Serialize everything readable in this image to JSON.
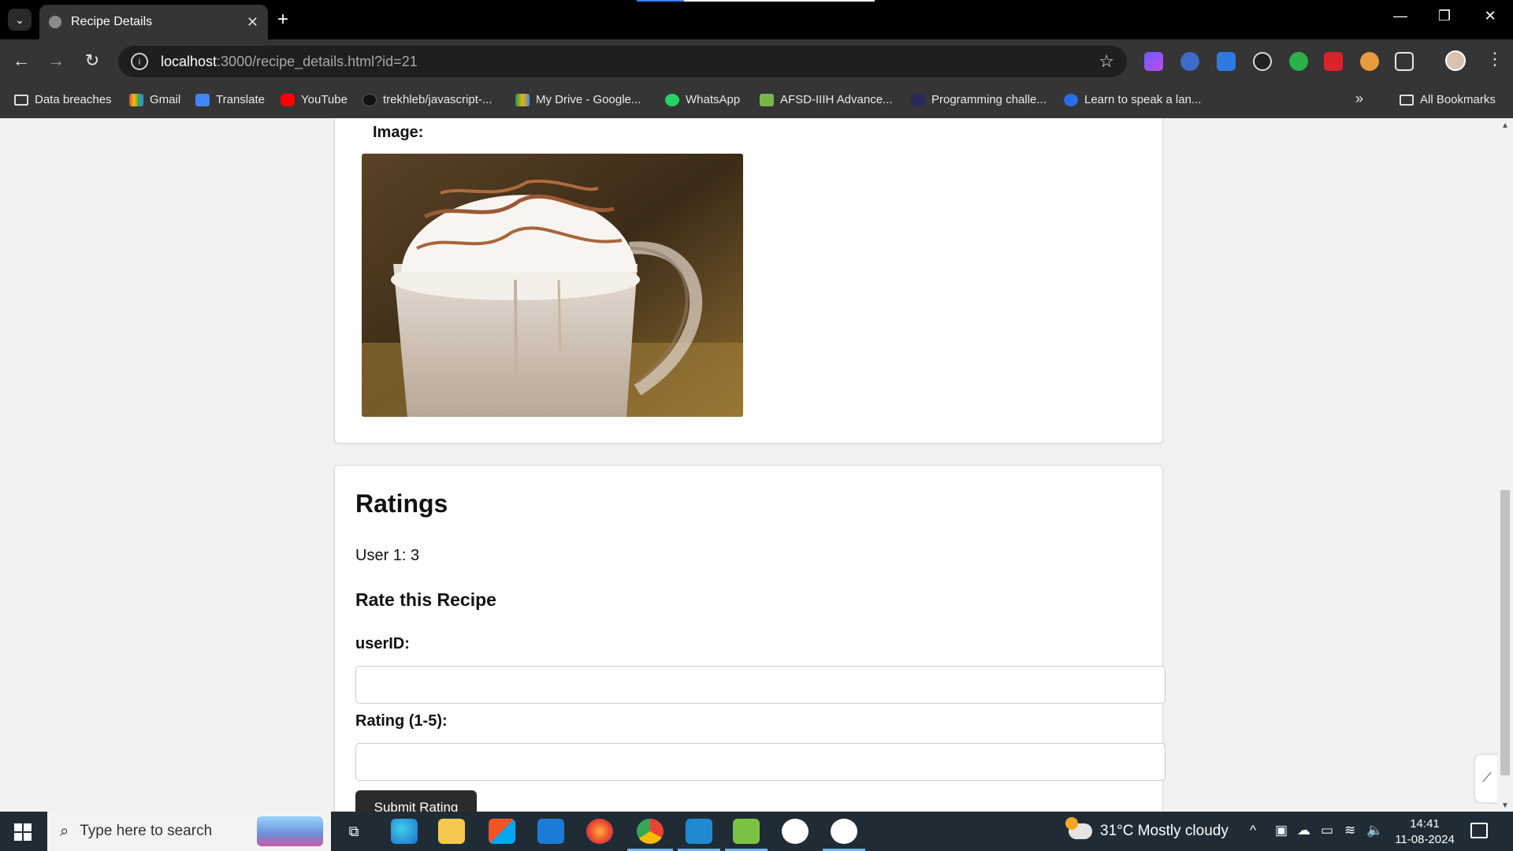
{
  "browser": {
    "tab_title": "Recipe Details",
    "tab_close": "✕",
    "new_tab": "+",
    "tab_menu": "⌄",
    "window_controls": {
      "minimize": "—",
      "restore": "❐",
      "close": "✕"
    },
    "url_host": "localhost",
    "url_path": ":3000/recipe_details.html?id=21",
    "nav": {
      "back": "←",
      "forward": "→",
      "reload": "↻"
    },
    "bookmarks": [
      {
        "label": "Data breaches",
        "icon": "folder-icon"
      },
      {
        "label": "Gmail",
        "icon": "gmail-icon"
      },
      {
        "label": "Translate",
        "icon": "translate-icon"
      },
      {
        "label": "YouTube",
        "icon": "youtube-icon"
      },
      {
        "label": "trekhleb/javascript-...",
        "icon": "github-icon"
      },
      {
        "label": "My Drive - Google...",
        "icon": "google-drive-icon"
      },
      {
        "label": "WhatsApp",
        "icon": "whatsapp-icon"
      },
      {
        "label": "AFSD-IIIH Advance...",
        "icon": "afsd-icon"
      },
      {
        "label": "Programming challe...",
        "icon": "programming-icon"
      },
      {
        "label": "Learn to speak a lan...",
        "icon": "language-icon"
      }
    ],
    "overflow": "»",
    "all_bookmarks": "All Bookmarks",
    "colors": {
      "tabbar": "#000000",
      "toolbar": "#353535",
      "accent": "#3b82f6"
    }
  },
  "page": {
    "image_label": "Image:",
    "ratings_heading": "Ratings",
    "rating_entry": "User 1: 3",
    "rate_heading": "Rate this Recipe",
    "userid_label": "userID:",
    "userid_value": "",
    "rating_label": "Rating (1-5):",
    "rating_value": "",
    "submit_label": "Submit Rating"
  },
  "taskbar": {
    "search_placeholder": "Type here to search",
    "weather": "31°C  Mostly cloudy",
    "time": "14:41",
    "date": "11-08-2024",
    "apps": [
      "task-view-icon",
      "edge-icon",
      "file-explorer-icon",
      "microsoft-store-icon",
      "mail-icon",
      "firefox-icon",
      "chrome-icon",
      "vscode-icon",
      "notepad-icon",
      "app-icon",
      "app-icon"
    ]
  }
}
